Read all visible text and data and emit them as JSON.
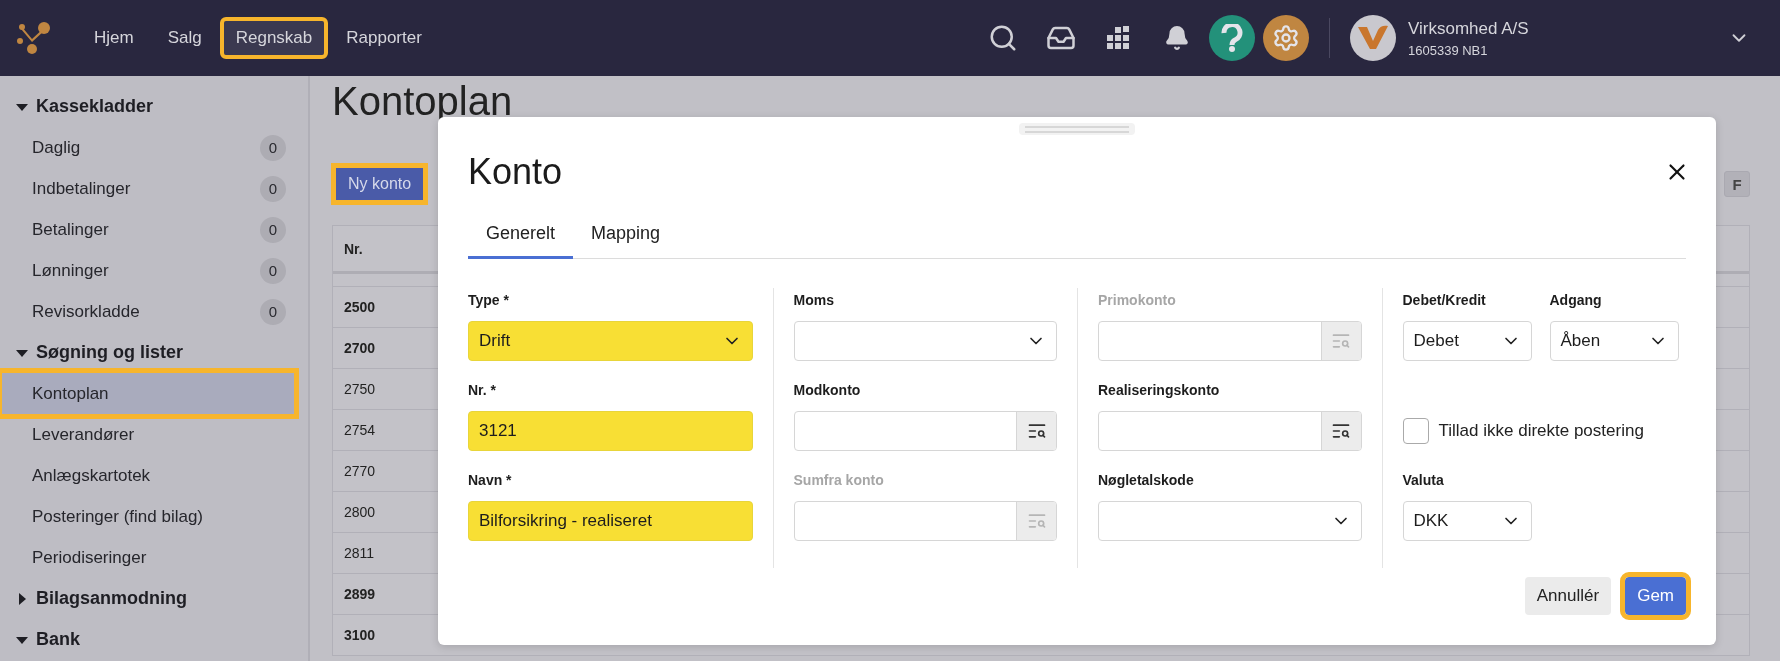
{
  "top_bar": {
    "nav": [
      {
        "label": "Hjem",
        "highlighted": false
      },
      {
        "label": "Salg",
        "highlighted": false
      },
      {
        "label": "Regnskab",
        "highlighted": true
      },
      {
        "label": "Rapporter",
        "highlighted": false
      }
    ],
    "company": {
      "name": "Virksomhed A/S",
      "id": "1605339 NB1"
    }
  },
  "sidebar": {
    "sections": [
      {
        "title": "Kassekladder",
        "expanded": true,
        "items": [
          {
            "label": "Daglig",
            "count": "0",
            "selected": false,
            "highlighted": false
          },
          {
            "label": "Indbetalinger",
            "count": "0",
            "selected": false,
            "highlighted": false
          },
          {
            "label": "Betalinger",
            "count": "0",
            "selected": false,
            "highlighted": false
          },
          {
            "label": "Lønninger",
            "count": "0",
            "selected": false,
            "highlighted": false
          },
          {
            "label": "Revisorkladde",
            "count": "0",
            "selected": false,
            "highlighted": false
          }
        ]
      },
      {
        "title": "Søgning og lister",
        "expanded": true,
        "items": [
          {
            "label": "Kontoplan",
            "selected": true,
            "highlighted": true
          },
          {
            "label": "Leverandører",
            "selected": false,
            "highlighted": false
          },
          {
            "label": "Anlægskartotek",
            "selected": false,
            "highlighted": false
          },
          {
            "label": "Posteringer (find bilag)",
            "selected": false,
            "highlighted": false
          },
          {
            "label": "Periodiseringer",
            "selected": false,
            "highlighted": false
          }
        ]
      },
      {
        "title": "Bilagsanmodning",
        "expanded": false
      },
      {
        "title": "Bank",
        "expanded": true
      }
    ]
  },
  "page": {
    "title": "Kontoplan",
    "new_button": {
      "label": "Ny konto",
      "highlighted": true
    },
    "toolbar_key": "F",
    "table": {
      "columns": [
        "Nr."
      ],
      "rows": [
        {
          "nr": "2500",
          "bold": true
        },
        {
          "nr": "2700",
          "bold": true
        },
        {
          "nr": "2750",
          "bold": false
        },
        {
          "nr": "2754",
          "bold": false
        },
        {
          "nr": "2770",
          "bold": false
        },
        {
          "nr": "2800",
          "bold": false
        },
        {
          "nr": "2811",
          "bold": false
        },
        {
          "nr": "2899",
          "bold": true
        },
        {
          "nr": "3100",
          "bold": true
        }
      ]
    }
  },
  "dialog": {
    "title": "Konto",
    "tabs": [
      {
        "label": "Generelt",
        "selected": true
      },
      {
        "label": "Mapping",
        "selected": false
      }
    ],
    "columns": [
      {
        "fields": [
          {
            "kind": "select",
            "label": "Type *",
            "value": "Drift",
            "disabled": false,
            "highlighted": true
          },
          {
            "kind": "text",
            "label": "Nr. *",
            "value": "3121",
            "disabled": false,
            "highlighted": true
          },
          {
            "kind": "text",
            "label": "Navn *",
            "value": "Bilforsikring - realiseret",
            "disabled": false,
            "highlighted": true
          }
        ]
      },
      {
        "fields": [
          {
            "kind": "select",
            "label": "Moms",
            "disabled": false,
            "highlighted": false
          },
          {
            "kind": "lookup",
            "label": "Modkonto",
            "disabled": false,
            "highlighted": false
          },
          {
            "kind": "lookup",
            "label": "Sumfra konto",
            "disabled": true,
            "highlighted": false
          }
        ]
      },
      {
        "fields": [
          {
            "kind": "lookup",
            "label": "Primokonto",
            "disabled": true,
            "highlighted": false
          },
          {
            "kind": "lookup",
            "label": "Realiseringskonto",
            "disabled": false,
            "highlighted": false
          },
          {
            "kind": "select",
            "label": "Nøgletalskode",
            "disabled": false,
            "highlighted": false
          }
        ]
      },
      {
        "fields": [
          {
            "kind": "select_pair",
            "items": [
              {
                "label": "Debet/Kredit",
                "value": "Debet"
              },
              {
                "label": "Adgang",
                "value": "Åben"
              }
            ]
          },
          {
            "kind": "checkbox",
            "label": "Tillad ikke direkte postering",
            "checked": false
          },
          {
            "kind": "small_select",
            "label": "Valuta",
            "value": "DKK",
            "disabled": false,
            "highlighted": false
          }
        ]
      }
    ],
    "buttons": [
      {
        "kind": "secondary",
        "label": "Annullér",
        "highlighted": false
      },
      {
        "kind": "primary",
        "label": "Gem",
        "highlighted": true
      }
    ]
  }
}
